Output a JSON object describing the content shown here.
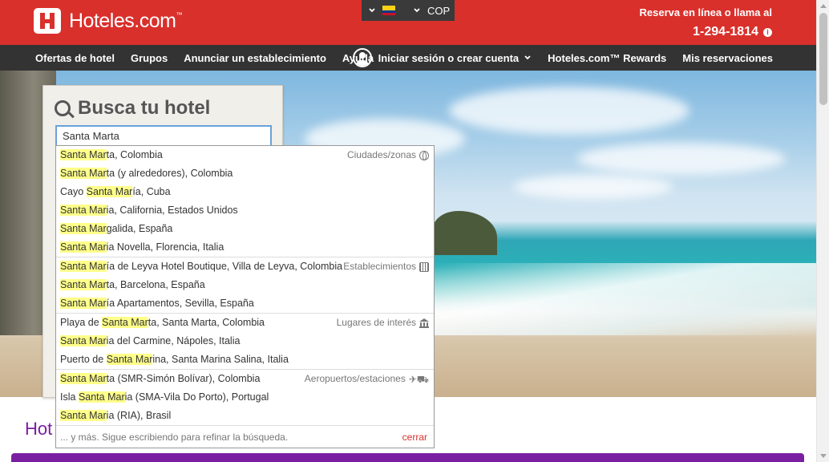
{
  "brand": {
    "name": "Hoteles.com",
    "tm": "™"
  },
  "locale": {
    "currency": "COP",
    "flag_colors": [
      "#fcd116",
      "#003893",
      "#ce1126"
    ]
  },
  "contact": {
    "line1": "Reserva en línea o llama al",
    "phone": "1-294-1814"
  },
  "nav": {
    "left": [
      "Ofertas de hotel",
      "Grupos",
      "Anunciar un establecimiento",
      "Ayuda"
    ],
    "signin": "Iniciar sesión o crear cuenta",
    "rewards": "Hoteles.com™ Rewards",
    "reservations": "Mis reservaciones"
  },
  "search": {
    "title": "Busca tu hotel",
    "value": "Santa Marta"
  },
  "autocomplete": {
    "groups": [
      {
        "category": "Ciudades/zonas",
        "icon": "globe-icon",
        "items": [
          {
            "pre": "",
            "hl": "Santa Mar",
            "post": "ta, Colombia"
          },
          {
            "pre": "",
            "hl": "Santa Mar",
            "post": "ta (y alrededores), Colombia"
          },
          {
            "pre": "Cayo ",
            "hl": "Santa Mar",
            "post": "ía, Cuba"
          },
          {
            "pre": "",
            "hl": "Santa Mar",
            "post": "ia, California, Estados Unidos"
          },
          {
            "pre": "",
            "hl": "Santa Mar",
            "post": "galida, España"
          },
          {
            "pre": "",
            "hl": "Santa Mar",
            "post": "ia Novella, Florencia, Italia"
          }
        ]
      },
      {
        "category": "Establecimientos",
        "icon": "building-icon",
        "items": [
          {
            "pre": "",
            "hl": "Santa Mar",
            "post": "ía de Leyva Hotel Boutique, Villa de Leyva, Colombia"
          },
          {
            "pre": "",
            "hl": "Santa Mar",
            "post": "ta, Barcelona, España"
          },
          {
            "pre": "",
            "hl": "Santa Mar",
            "post": "ía Apartamentos, Sevilla, España"
          }
        ]
      },
      {
        "category": "Lugares de interés",
        "icon": "landmark-icon",
        "items": [
          {
            "pre": "Playa de ",
            "hl": "Santa Mar",
            "post": "ta, Santa Marta, Colombia"
          },
          {
            "pre": "",
            "hl": "Santa Mar",
            "post": "ia del Carmine, Nápoles, Italia"
          },
          {
            "pre": "Puerto de ",
            "hl": "Santa Mar",
            "post": "ina, Santa Marina Salina, Italia"
          }
        ]
      },
      {
        "category": "Aeropuertos/estaciones",
        "icon": "plane-train-icon",
        "items": [
          {
            "pre": "",
            "hl": "Santa Mar",
            "post": "ta (SMR-Simón Bolívar), Colombia"
          },
          {
            "pre": "Isla ",
            "hl": "Santa Mar",
            "post": "ia (SMA-Vila Do Porto), Portugal"
          },
          {
            "pre": "",
            "hl": "Santa Mar",
            "post": "ia (RIA), Brasil"
          }
        ]
      }
    ],
    "more_text": "... y más. Sigue escribiendo para refinar la búsqueda.",
    "close_label": "cerrar"
  },
  "below": {
    "heading": "Hot"
  }
}
